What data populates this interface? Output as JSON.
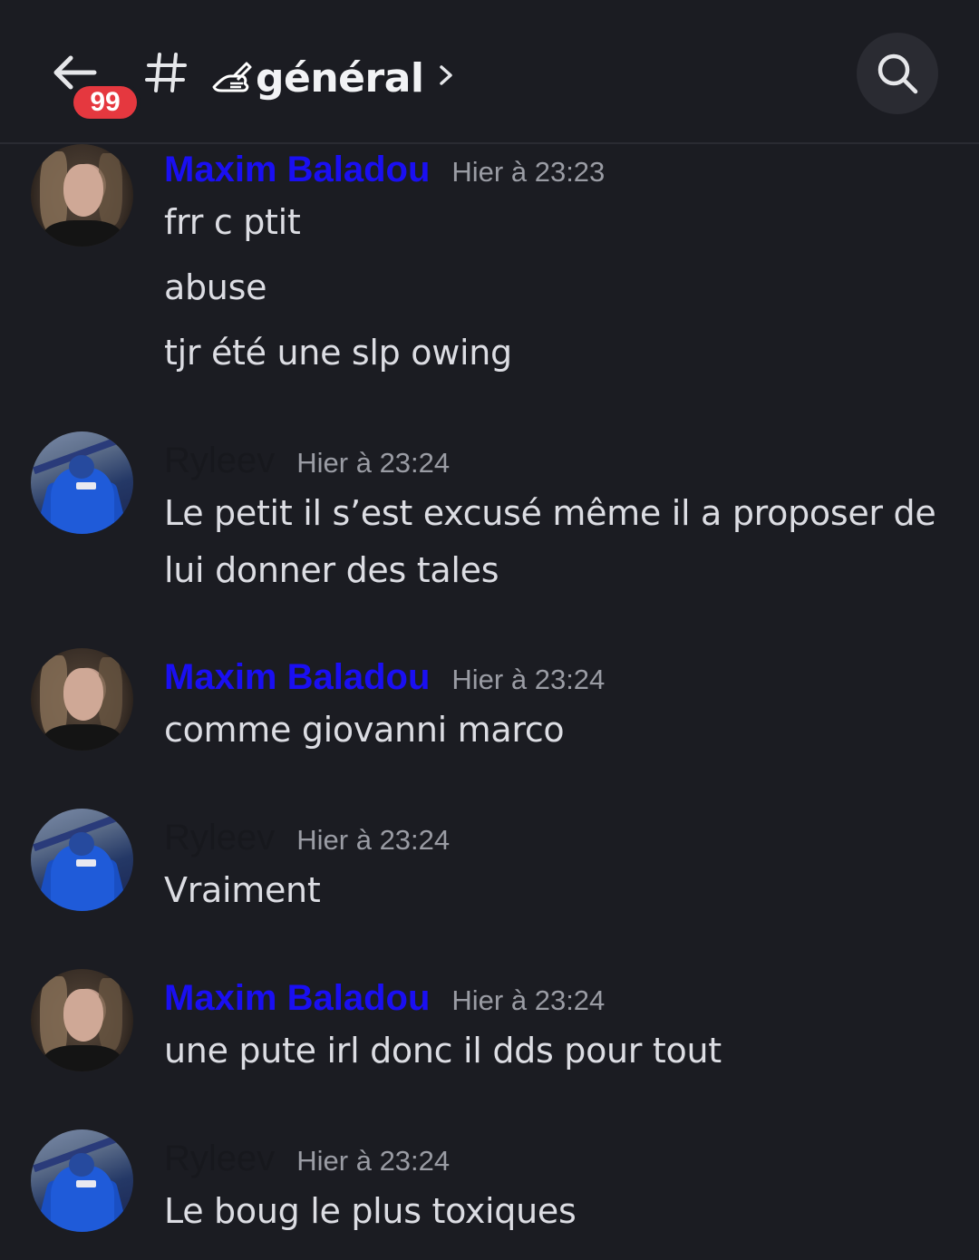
{
  "header": {
    "back_label": "Back",
    "unread_badge": "99",
    "channel_prefix": "#",
    "channel_name": "général",
    "channel_emoji_icon": "writing-hand-icon",
    "chevron_icon": "chevron-right-icon",
    "search_icon": "search-icon"
  },
  "colors": {
    "background": "#1b1c22",
    "maxim_name": "#1a0ff2",
    "ryleev_name": "#17181d",
    "timestamp": "#9a9ca4",
    "badge": "#e5383f"
  },
  "messages": [
    {
      "author": "Maxim Baladou",
      "time": "Hier à 23:23",
      "lines": [
        "frr c ptit",
        "abuse",
        "tjr été une slp owing"
      ]
    },
    {
      "author": "Ryleev",
      "time": "Hier à 23:24",
      "lines": [
        "Le petit il s’est excusé même il a proposer de",
        "lui donner des tales"
      ]
    },
    {
      "author": "Maxim Baladou",
      "time": "Hier à 23:24",
      "lines": [
        "comme giovanni marco"
      ]
    },
    {
      "author": "Ryleev",
      "time": "Hier à 23:24",
      "lines": [
        "Vraiment"
      ]
    },
    {
      "author": "Maxim Baladou",
      "time": "Hier à 23:24",
      "lines": [
        "une pute irl donc il dds pour tout"
      ]
    },
    {
      "author": "Ryleev",
      "time": "Hier à 23:24",
      "lines": [
        "Le boug le plus toxiques"
      ]
    }
  ]
}
